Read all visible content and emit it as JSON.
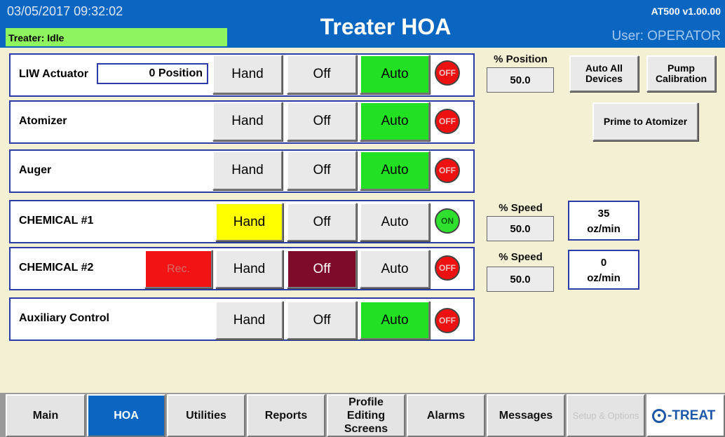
{
  "header": {
    "datetime": "03/05/2017 09:32:02",
    "status": "Treater: Idle",
    "title": "Treater HOA",
    "version": "AT500 v1.00.00",
    "user": "User: OPERATOR"
  },
  "rows": [
    {
      "label": "LIW Actuator",
      "extra": "0 Position",
      "hand": "Hand",
      "off": "Off",
      "auto": "Auto",
      "lamp": "OFF"
    },
    {
      "label": "Atomizer",
      "hand": "Hand",
      "off": "Off",
      "auto": "Auto",
      "lamp": "OFF"
    },
    {
      "label": "Auger",
      "hand": "Hand",
      "off": "Off",
      "auto": "Auto",
      "lamp": "OFF"
    },
    {
      "label": "CHEMICAL #1",
      "hand": "Hand",
      "off": "Off",
      "auto": "Auto",
      "lamp": "ON"
    },
    {
      "label": "CHEMICAL #2",
      "extra": "Rec.",
      "hand": "Hand",
      "off": "Off",
      "auto": "Auto",
      "lamp": "OFF"
    },
    {
      "label": "Auxiliary Control",
      "hand": "Hand",
      "off": "Off",
      "auto": "Auto",
      "lamp": "OFF"
    }
  ],
  "right_panel": {
    "position_label": "% Position",
    "position_value": "50.0",
    "auto_all": "Auto All Devices",
    "pump_calibration": "Pump Calibration",
    "prime": "Prime to Atomizer",
    "chem1_speed_label": "% Speed",
    "chem1_speed_value": "50.0",
    "chem1_rate_value": "35",
    "chem1_rate_unit": "oz/min",
    "chem2_speed_label": "% Speed",
    "chem2_speed_value": "50.0",
    "chem2_rate_value": "0",
    "chem2_rate_unit": "oz/min"
  },
  "tabs": [
    {
      "label": "Main"
    },
    {
      "label": "HOA"
    },
    {
      "label": "Utilities"
    },
    {
      "label": "Reports"
    },
    {
      "label": "Profile Editing Screens"
    },
    {
      "label": "Alarms"
    },
    {
      "label": "Messages"
    },
    {
      "label": "Setup & Options"
    }
  ],
  "logo_text": "-TREAT",
  "colors": {
    "header_blue": "#0b66c2",
    "auto_green": "#22e022",
    "hand_yellow": "#ffff00",
    "off_maroon": "#7e0b2a",
    "lamp_red": "#ee1111",
    "panel_bg": "#f3f0d3"
  }
}
